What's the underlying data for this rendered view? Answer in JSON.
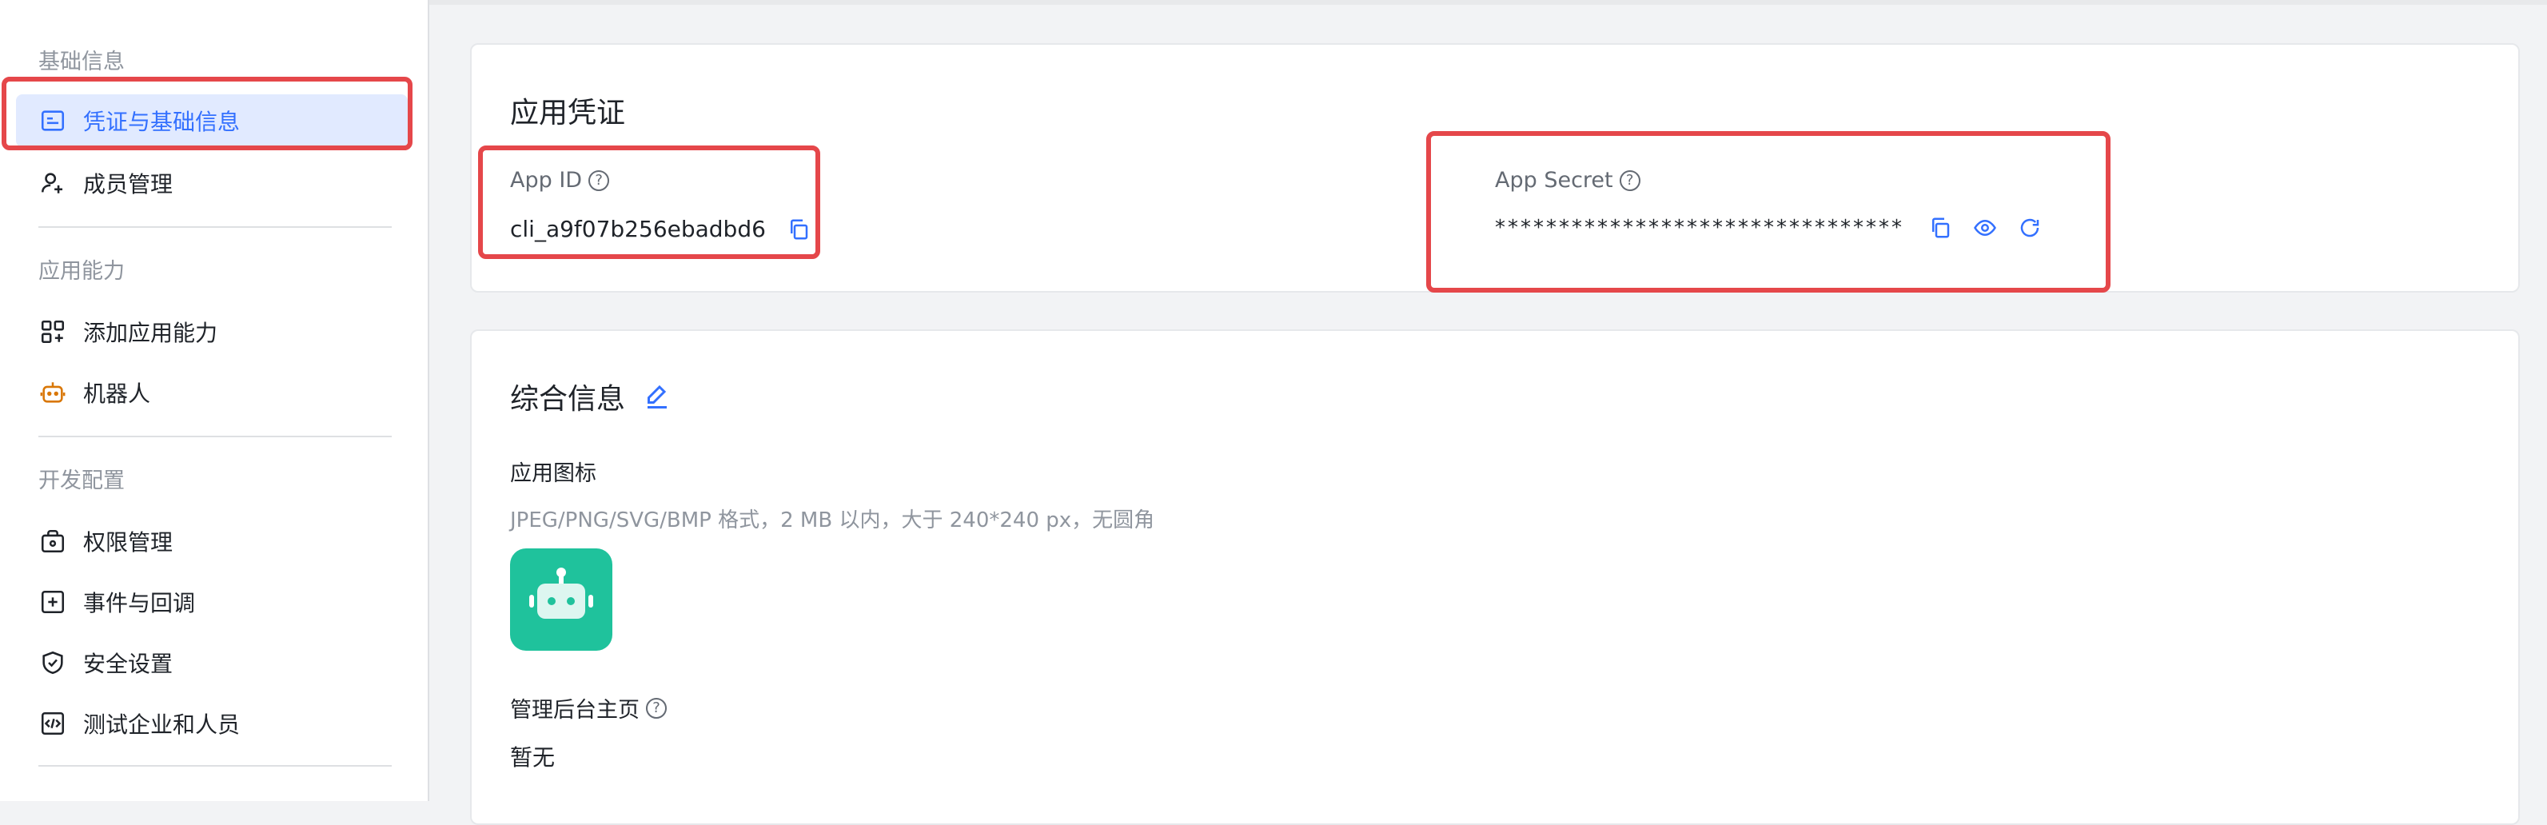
{
  "sidebar": {
    "groups": [
      {
        "title": "基础信息"
      },
      {
        "title": "应用能力"
      },
      {
        "title": "开发配置"
      }
    ],
    "items": [
      {
        "label": "凭证与基础信息",
        "icon": "credential-icon",
        "active": true
      },
      {
        "label": "成员管理",
        "icon": "add-member-icon"
      },
      {
        "label": "添加应用能力",
        "icon": "grid-add-icon"
      },
      {
        "label": "机器人",
        "icon": "robot-icon"
      },
      {
        "label": "权限管理",
        "icon": "lock-bag-icon"
      },
      {
        "label": "事件与回调",
        "icon": "event-plus-icon"
      },
      {
        "label": "安全设置",
        "icon": "shield-icon"
      },
      {
        "label": "测试企业和人员",
        "icon": "code-icon"
      }
    ]
  },
  "credentials": {
    "title": "应用凭证",
    "app_id_label": "App ID",
    "app_id_value": "cli_a9f07b256ebadbd6",
    "app_secret_label": "App Secret",
    "app_secret_value": "********************************"
  },
  "general": {
    "title": "综合信息",
    "icon_label": "应用图标",
    "icon_hint": "JPEG/PNG/SVG/BMP 格式，2 MB 以内，大于 240*240 px，无圆角",
    "admin_home_label": "管理后台主页",
    "admin_home_value": "暂无"
  },
  "colors": {
    "accent": "#3370ff",
    "highlight": "#e5474a",
    "app_icon_bg": "#1fc29c"
  }
}
